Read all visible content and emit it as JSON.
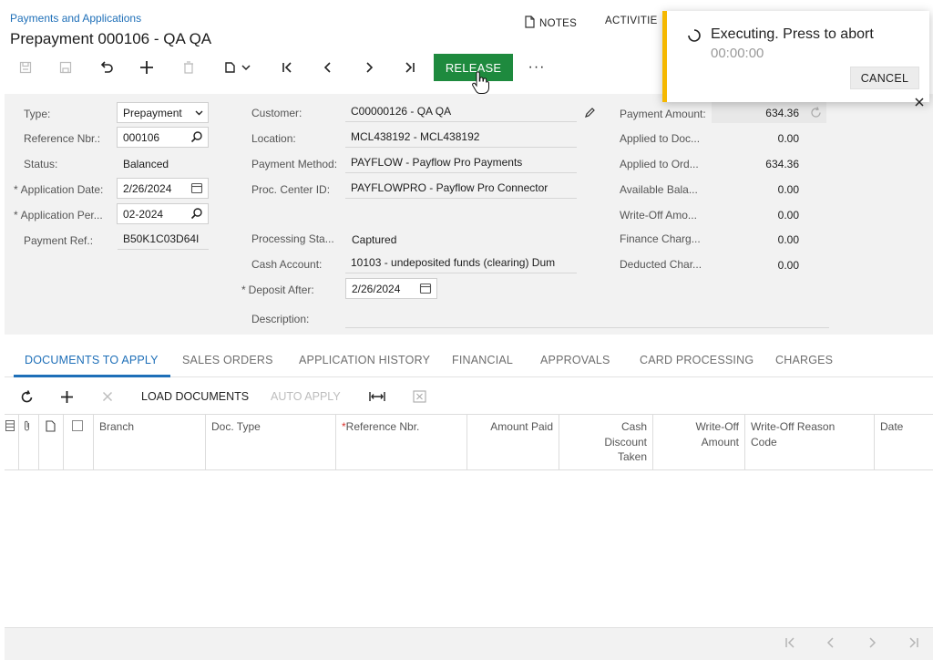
{
  "header": {
    "breadcrumb": "Payments and Applications",
    "title": "Prepayment 000106 - QA QA",
    "notes_label": "NOTES",
    "activities_label": "ACTIVITIE"
  },
  "toolbar": {
    "release_label": "RELEASE",
    "more_label": "···"
  },
  "form": {
    "col1": {
      "type_label": "Type:",
      "type_value": "Prepayment",
      "refnbr_label": "Reference Nbr.:",
      "refnbr_value": "000106",
      "status_label": "Status:",
      "status_value": "Balanced",
      "appdate_label": "Application Date:",
      "appdate_value": "2/26/2024",
      "appper_label": "Application Per...",
      "appper_value": "02-2024",
      "payref_label": "Payment Ref.:",
      "payref_value": "B50K1C03D64I"
    },
    "col2": {
      "customer_label": "Customer:",
      "customer_value": "C00000126 - QA QA",
      "location_label": "Location:",
      "location_value": "MCL438192 - MCL438192",
      "paymethod_label": "Payment Method:",
      "paymethod_value": "PAYFLOW - Payflow Pro Payments",
      "proccenter_label": "Proc. Center ID:",
      "proccenter_value": "PAYFLOWPRO - Payflow Pro Connector",
      "procstatus_label": "Processing Sta...",
      "procstatus_value": "Captured",
      "cashacct_label": "Cash Account:",
      "cashacct_value": "10103 - undeposited funds (clearing) Dum",
      "depositafter_label": "Deposit After:",
      "depositafter_value": "2/26/2024",
      "description_label": "Description:"
    },
    "col3": {
      "payment_amount_label": "Payment Amount:",
      "payment_amount_value": "634.36",
      "applied_doc_label": "Applied to Doc...",
      "applied_doc_value": "0.00",
      "applied_ord_label": "Applied to Ord...",
      "applied_ord_value": "634.36",
      "available_label": "Available Bala...",
      "available_value": "0.00",
      "writeoff_label": "Write-Off Amo...",
      "writeoff_value": "0.00",
      "finance_label": "Finance Charg...",
      "finance_value": "0.00",
      "deducted_label": "Deducted Char...",
      "deducted_value": "0.00"
    }
  },
  "tabs": [
    {
      "label": "DOCUMENTS TO APPLY"
    },
    {
      "label": "SALES ORDERS"
    },
    {
      "label": "APPLICATION HISTORY"
    },
    {
      "label": "FINANCIAL"
    },
    {
      "label": "APPROVALS"
    },
    {
      "label": "CARD PROCESSING"
    },
    {
      "label": "CHARGES"
    }
  ],
  "grid_toolbar": {
    "load_documents_label": "LOAD DOCUMENTS",
    "auto_apply_label": "AUTO APPLY"
  },
  "grid": {
    "columns": {
      "branch": "Branch",
      "doc_type": "Doc. Type",
      "ref_nbr": "Reference Nbr.",
      "amount_paid": "Amount Paid",
      "cash_discount_1": "Cash",
      "cash_discount_2": "Discount",
      "cash_discount_3": "Taken",
      "writeoff_amount_1": "Write-Off",
      "writeoff_amount_2": "Amount",
      "writeoff_reason_1": "Write-Off Reason",
      "writeoff_reason_2": "Code",
      "date": "Date"
    }
  },
  "toast": {
    "message": "Executing. Press to abort",
    "timer": "00:00:00",
    "cancel_label": "CANCEL"
  },
  "colors": {
    "accent": "#1e6fb8",
    "release_button": "#1e8a3e",
    "toast_border": "#f5b800"
  }
}
